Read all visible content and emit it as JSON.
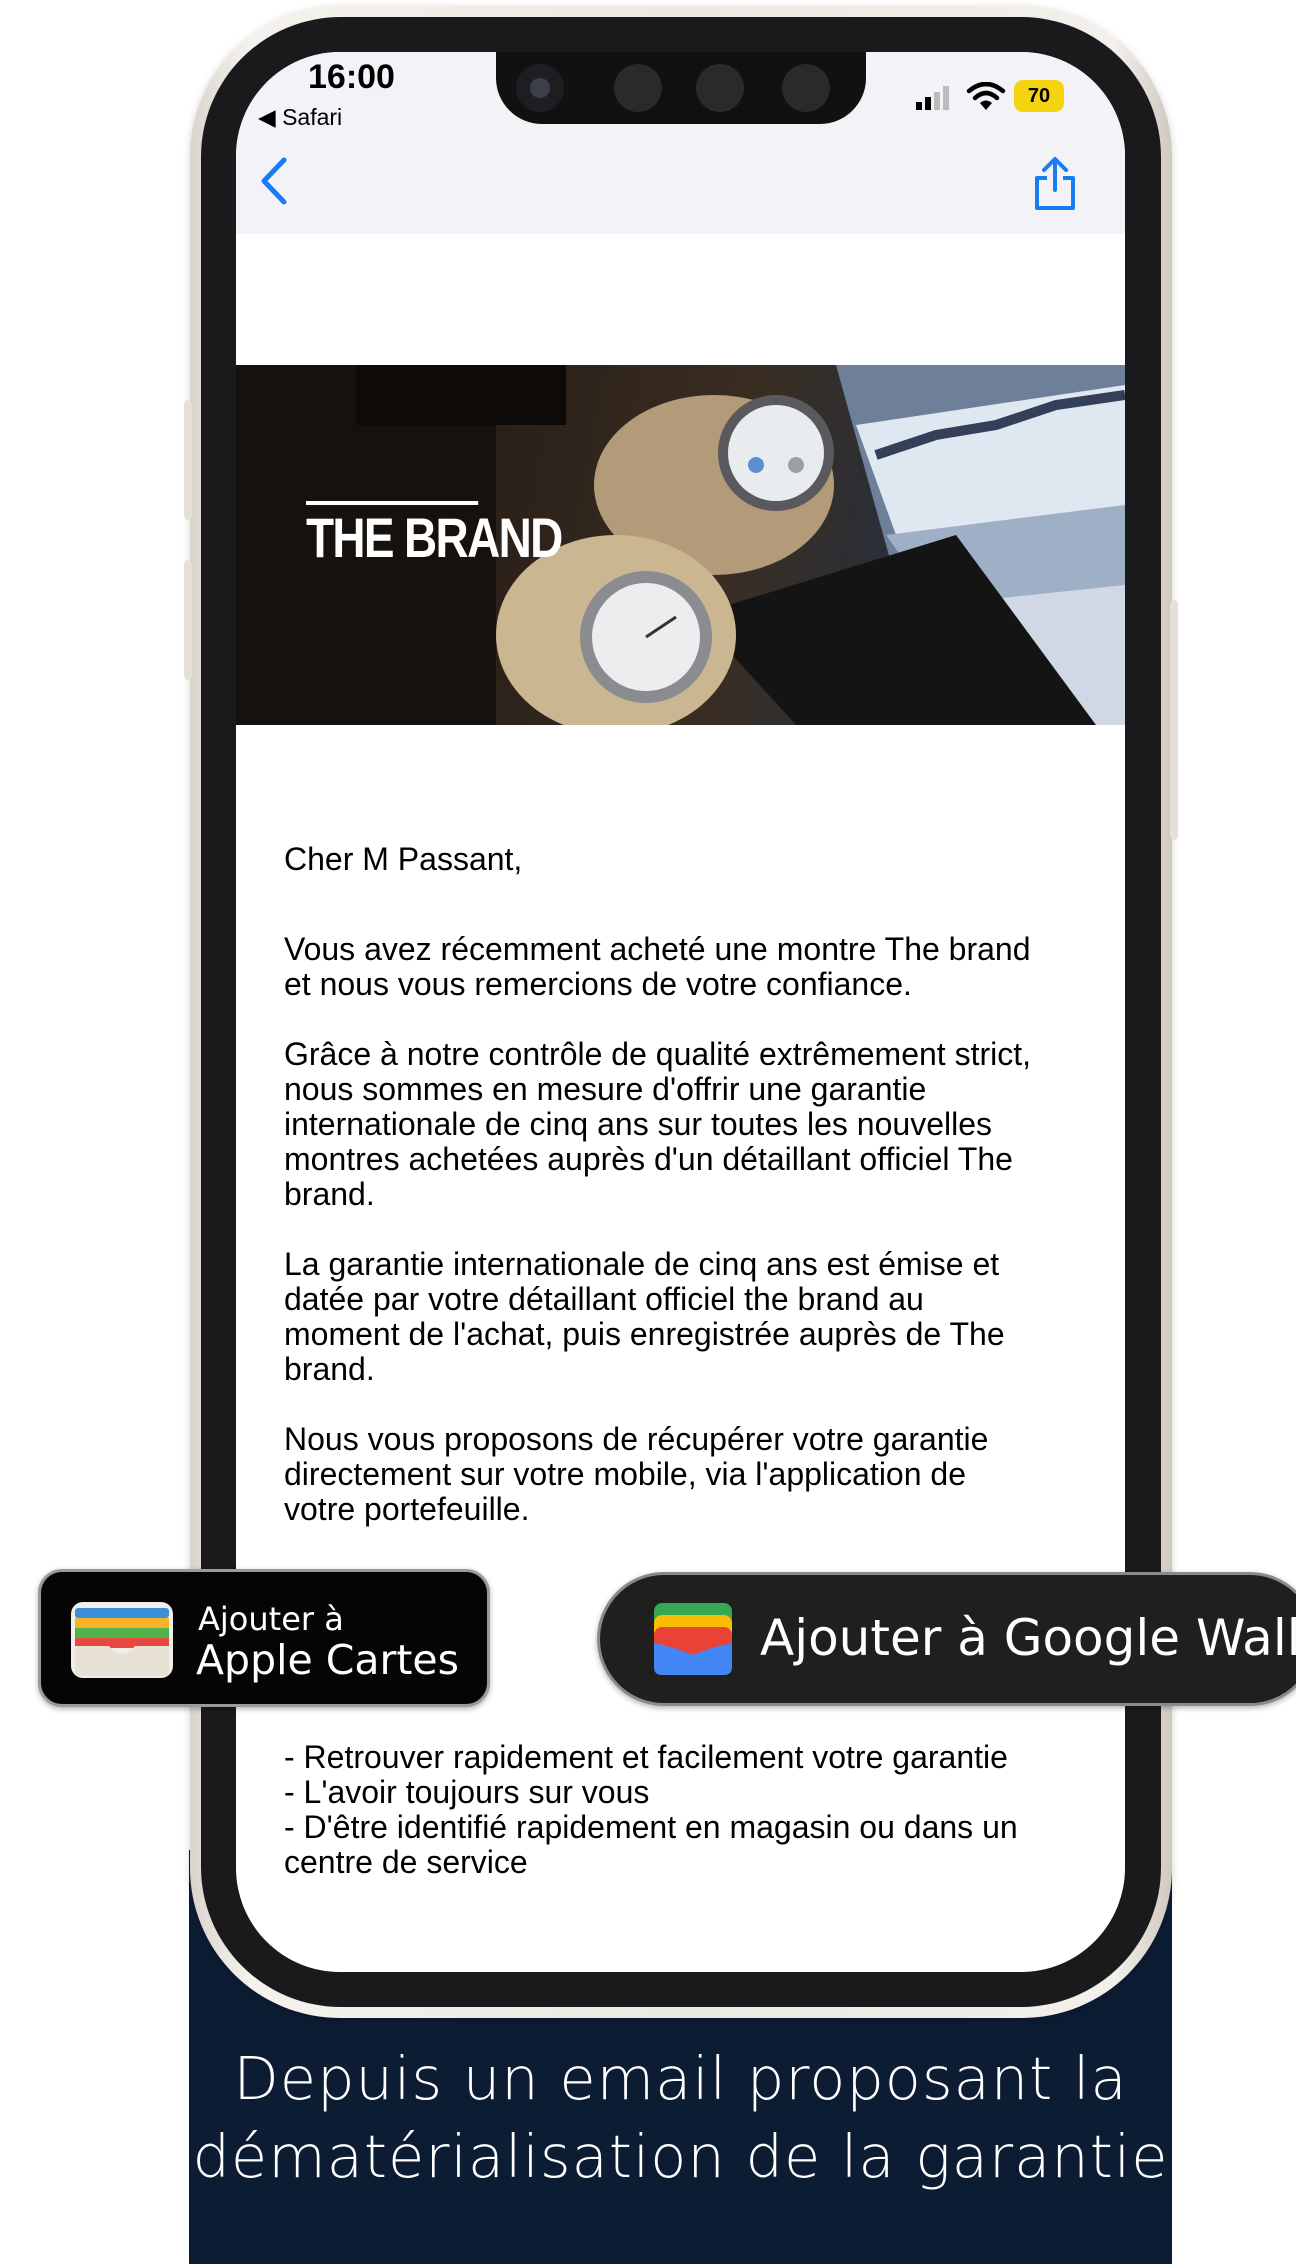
{
  "status_bar": {
    "time": "16:00",
    "back_app": "◀ Safari",
    "battery": "70"
  },
  "email": {
    "hero_brand": "THE BRAND",
    "greeting": "Cher M Passant,",
    "paragraphs": [
      [
        "Vous avez récemment acheté une montre The brand",
        "et nous vous remercions de votre confiance."
      ],
      [
        "Grâce à notre contrôle de qualité extrêmement strict,",
        "nous sommes en mesure d'offrir une garantie",
        "internationale de cinq ans sur toutes les nouvelles",
        "montres achetées auprès d'un détaillant officiel The",
        "brand."
      ],
      [
        "La garantie internationale de cinq ans est émise et",
        "datée par votre détaillant officiel the brand au",
        "moment de l'achat, puis enregistrée auprès de The",
        "brand."
      ],
      [
        "Nous vous proposons de récupérer votre garantie",
        "directement sur votre mobile, via l'application de",
        "votre portefeuille."
      ]
    ],
    "benefits": [
      "- Retrouver rapidement et facilement votre garantie",
      "- L'avoir toujours sur vous",
      "- D'être identifié rapidement en magasin ou dans un",
      "centre de service"
    ]
  },
  "wallet_buttons": {
    "apple_small": "Ajouter à",
    "apple_big": "Apple Cartes",
    "google": "Ajouter à Google Wallet"
  },
  "caption": {
    "line1": "Depuis un email proposant la",
    "line2": "dématérialisation de la garantie"
  },
  "colors": {
    "caption_panel": "#0c1c33",
    "ios_blue": "#1a7cf5",
    "battery_yellow": "#f5d40f"
  }
}
